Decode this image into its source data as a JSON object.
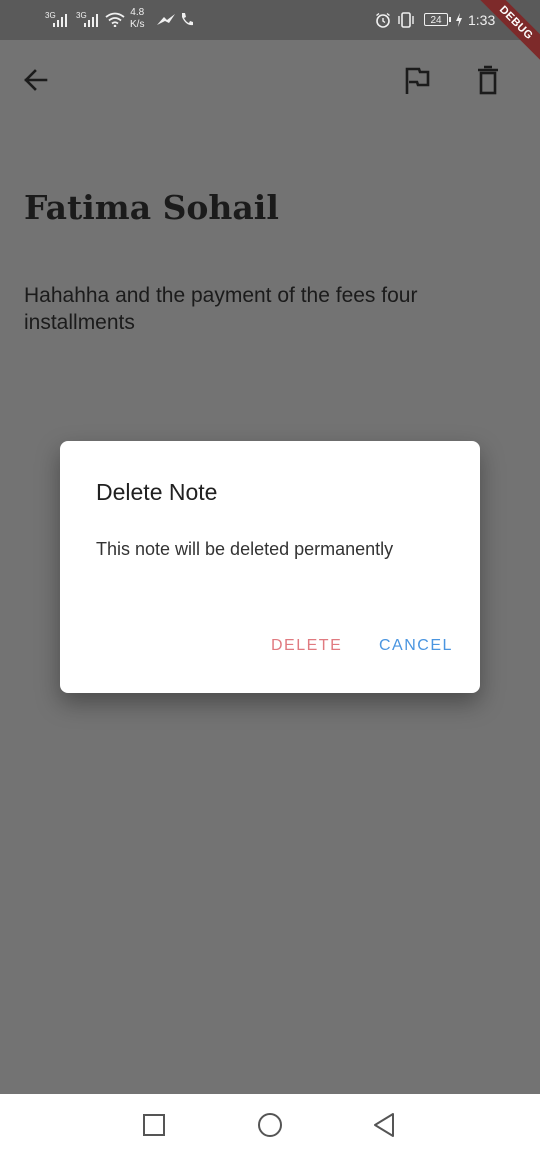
{
  "status_bar": {
    "net1": "3G",
    "net2": "3G",
    "speed_value": "4.8",
    "speed_unit": "K/s",
    "battery": "24",
    "time": "1:33"
  },
  "debug_banner": "DEBUG",
  "app_bar": {
    "back_icon": "arrow-left",
    "flag_icon": "flag-outline",
    "delete_icon": "trash-outline"
  },
  "note": {
    "title": "Fatima Sohail",
    "body": "Hahahha and the payment of the fees four installments"
  },
  "dialog": {
    "title": "Delete Note",
    "message": "This note will be deleted permanently",
    "delete_label": "DELETE",
    "cancel_label": "CANCEL"
  },
  "nav": {
    "recents_icon": "square",
    "home_icon": "circle",
    "back_icon": "triangle-left"
  }
}
